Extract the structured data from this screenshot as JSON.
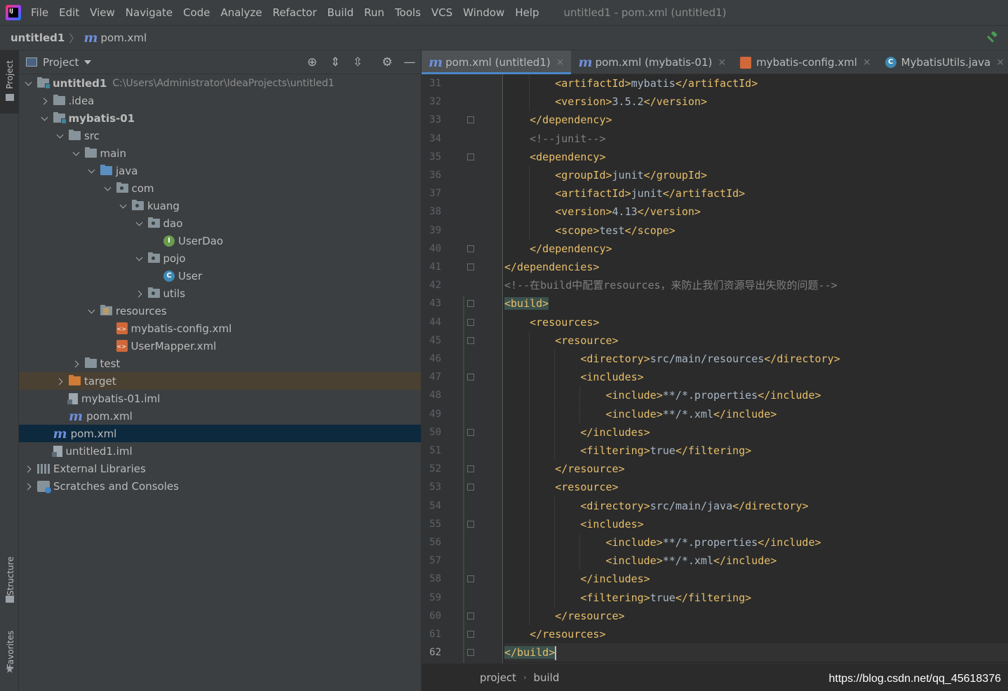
{
  "menubar": {
    "items": [
      "File",
      "Edit",
      "View",
      "Navigate",
      "Code",
      "Analyze",
      "Refactor",
      "Build",
      "Run",
      "Tools",
      "VCS",
      "Window",
      "Help"
    ],
    "window_title": "untitled1 - pom.xml (untitled1)"
  },
  "navbar": {
    "project": "untitled1",
    "file": "pom.xml"
  },
  "side_strip": {
    "project": "Project",
    "structure": "Structure",
    "favorites": "Favorites"
  },
  "project_panel": {
    "title": "Project",
    "tree": [
      {
        "label": "untitled1",
        "path": "C:\\Users\\Administrator\\IdeaProjects\\untitled1",
        "depth": 0,
        "chevron": "down",
        "icon": "module-folder-icon",
        "bold": true
      },
      {
        "label": ".idea",
        "depth": 1,
        "chevron": "right",
        "icon": "folder-icon"
      },
      {
        "label": "mybatis-01",
        "depth": 1,
        "chevron": "down",
        "icon": "module-folder-icon",
        "bold": true
      },
      {
        "label": "src",
        "depth": 2,
        "chevron": "down",
        "icon": "folder-icon"
      },
      {
        "label": "main",
        "depth": 3,
        "chevron": "down",
        "icon": "folder-icon"
      },
      {
        "label": "java",
        "depth": 4,
        "chevron": "down",
        "icon": "source-folder-icon"
      },
      {
        "label": "com",
        "depth": 5,
        "chevron": "down",
        "icon": "package-icon"
      },
      {
        "label": "kuang",
        "depth": 6,
        "chevron": "down",
        "icon": "package-icon"
      },
      {
        "label": "dao",
        "depth": 7,
        "chevron": "down",
        "icon": "package-icon"
      },
      {
        "label": "UserDao",
        "depth": 8,
        "chevron": "none",
        "icon": "interface-icon"
      },
      {
        "label": "pojo",
        "depth": 7,
        "chevron": "down",
        "icon": "package-icon"
      },
      {
        "label": "User",
        "depth": 8,
        "chevron": "none",
        "icon": "class-icon"
      },
      {
        "label": "utils",
        "depth": 7,
        "chevron": "right",
        "icon": "package-icon"
      },
      {
        "label": "resources",
        "depth": 4,
        "chevron": "down",
        "icon": "resources-folder-icon"
      },
      {
        "label": "mybatis-config.xml",
        "depth": 5,
        "chevron": "none",
        "icon": "xml-file-icon"
      },
      {
        "label": "UserMapper.xml",
        "depth": 5,
        "chevron": "none",
        "icon": "xml-file-icon"
      },
      {
        "label": "test",
        "depth": 3,
        "chevron": "right",
        "icon": "folder-icon"
      },
      {
        "label": "target",
        "depth": 2,
        "chevron": "right",
        "icon": "excluded-folder-icon",
        "state": "excluded"
      },
      {
        "label": "mybatis-01.iml",
        "depth": 2,
        "chevron": "none",
        "icon": "iml-file-icon"
      },
      {
        "label": "pom.xml",
        "depth": 2,
        "chevron": "none",
        "icon": "maven-file-icon"
      },
      {
        "label": "pom.xml",
        "depth": 1,
        "chevron": "none",
        "icon": "maven-file-icon",
        "state": "selected"
      },
      {
        "label": "untitled1.iml",
        "depth": 1,
        "chevron": "none",
        "icon": "iml-file-icon"
      },
      {
        "label": "External Libraries",
        "depth": 0,
        "chevron": "right",
        "icon": "libraries-icon"
      },
      {
        "label": "Scratches and Consoles",
        "depth": 0,
        "chevron": "right",
        "icon": "scratches-icon"
      }
    ]
  },
  "editor_tabs": [
    {
      "label": "pom.xml (untitled1)",
      "icon": "maven-file-icon",
      "active": true
    },
    {
      "label": "pom.xml (mybatis-01)",
      "icon": "maven-file-icon",
      "active": false
    },
    {
      "label": "mybatis-config.xml",
      "icon": "xml-file-icon",
      "active": false
    },
    {
      "label": "MybatisUtils.java",
      "icon": "class-icon",
      "active": false
    }
  ],
  "editor": {
    "current_line": 62,
    "lines": [
      {
        "n": 31,
        "indent": 5,
        "parts": [
          [
            "tag",
            "<artifactId>"
          ],
          [
            "txt",
            "mybatis"
          ],
          [
            "tag",
            "</artifactId>"
          ]
        ]
      },
      {
        "n": 32,
        "indent": 5,
        "parts": [
          [
            "tag",
            "<version>"
          ],
          [
            "txt",
            "3.5.2"
          ],
          [
            "tag",
            "</version>"
          ]
        ]
      },
      {
        "n": 33,
        "indent": 4,
        "fold": true,
        "parts": [
          [
            "tag",
            "</dependency>"
          ]
        ]
      },
      {
        "n": 34,
        "indent": 4,
        "parts": [
          [
            "cmt",
            "<!--junit-->"
          ]
        ]
      },
      {
        "n": 35,
        "indent": 4,
        "fold": true,
        "parts": [
          [
            "tag",
            "<dependency>"
          ]
        ]
      },
      {
        "n": 36,
        "indent": 5,
        "parts": [
          [
            "tag",
            "<groupId>"
          ],
          [
            "txt",
            "junit"
          ],
          [
            "tag",
            "</groupId>"
          ]
        ]
      },
      {
        "n": 37,
        "indent": 5,
        "parts": [
          [
            "tag",
            "<artifactId>"
          ],
          [
            "txt",
            "junit"
          ],
          [
            "tag",
            "</artifactId>"
          ]
        ]
      },
      {
        "n": 38,
        "indent": 5,
        "parts": [
          [
            "tag",
            "<version>"
          ],
          [
            "txt",
            "4.13"
          ],
          [
            "tag",
            "</version>"
          ]
        ]
      },
      {
        "n": 39,
        "indent": 5,
        "parts": [
          [
            "tag",
            "<scope>"
          ],
          [
            "txt",
            "test"
          ],
          [
            "tag",
            "</scope>"
          ]
        ]
      },
      {
        "n": 40,
        "indent": 4,
        "fold": true,
        "parts": [
          [
            "tag",
            "</dependency>"
          ]
        ]
      },
      {
        "n": 41,
        "indent": 3,
        "fold": true,
        "parts": [
          [
            "tag",
            "</dependencies>"
          ]
        ]
      },
      {
        "n": 42,
        "indent": 3,
        "parts": [
          [
            "cmt",
            "<!--在build中配置resources，来防止我们资源导出失败的问题-->"
          ]
        ]
      },
      {
        "n": 43,
        "indent": 3,
        "fold": true,
        "parts": [
          [
            "taghl",
            "<build>"
          ]
        ]
      },
      {
        "n": 44,
        "indent": 4,
        "fold": true,
        "parts": [
          [
            "tag",
            "<resources>"
          ]
        ]
      },
      {
        "n": 45,
        "indent": 5,
        "fold": true,
        "parts": [
          [
            "tag",
            "<resource>"
          ]
        ]
      },
      {
        "n": 46,
        "indent": 6,
        "parts": [
          [
            "tag",
            "<directory>"
          ],
          [
            "txt",
            "src/main/resources"
          ],
          [
            "tag",
            "</directory>"
          ]
        ]
      },
      {
        "n": 47,
        "indent": 6,
        "fold": true,
        "parts": [
          [
            "tag",
            "<includes>"
          ]
        ]
      },
      {
        "n": 48,
        "indent": 7,
        "parts": [
          [
            "tag",
            "<include>"
          ],
          [
            "txt",
            "**/*.properties"
          ],
          [
            "tag",
            "</include>"
          ]
        ]
      },
      {
        "n": 49,
        "indent": 7,
        "parts": [
          [
            "tag",
            "<include>"
          ],
          [
            "txt",
            "**/*.xml"
          ],
          [
            "tag",
            "</include>"
          ]
        ]
      },
      {
        "n": 50,
        "indent": 6,
        "fold": true,
        "parts": [
          [
            "tag",
            "</includes>"
          ]
        ]
      },
      {
        "n": 51,
        "indent": 6,
        "parts": [
          [
            "tag",
            "<filtering>"
          ],
          [
            "txt",
            "true"
          ],
          [
            "tag",
            "</filtering>"
          ]
        ]
      },
      {
        "n": 52,
        "indent": 5,
        "fold": true,
        "parts": [
          [
            "tag",
            "</resource>"
          ]
        ]
      },
      {
        "n": 53,
        "indent": 5,
        "fold": true,
        "parts": [
          [
            "tag",
            "<resource>"
          ]
        ]
      },
      {
        "n": 54,
        "indent": 6,
        "parts": [
          [
            "tag",
            "<directory>"
          ],
          [
            "txt",
            "src/main/java"
          ],
          [
            "tag",
            "</directory>"
          ]
        ]
      },
      {
        "n": 55,
        "indent": 6,
        "fold": true,
        "parts": [
          [
            "tag",
            "<includes>"
          ]
        ]
      },
      {
        "n": 56,
        "indent": 7,
        "parts": [
          [
            "tag",
            "<include>"
          ],
          [
            "txt",
            "**/*.properties"
          ],
          [
            "tag",
            "</include>"
          ]
        ]
      },
      {
        "n": 57,
        "indent": 7,
        "parts": [
          [
            "tag",
            "<include>"
          ],
          [
            "txt",
            "**/*.xml"
          ],
          [
            "tag",
            "</include>"
          ]
        ]
      },
      {
        "n": 58,
        "indent": 6,
        "fold": true,
        "parts": [
          [
            "tag",
            "</includes>"
          ]
        ]
      },
      {
        "n": 59,
        "indent": 6,
        "parts": [
          [
            "tag",
            "<filtering>"
          ],
          [
            "txt",
            "true"
          ],
          [
            "tag",
            "</filtering>"
          ]
        ]
      },
      {
        "n": 60,
        "indent": 5,
        "fold": true,
        "parts": [
          [
            "tag",
            "</resource>"
          ]
        ]
      },
      {
        "n": 61,
        "indent": 4,
        "fold": true,
        "parts": [
          [
            "tag",
            "</resources>"
          ]
        ]
      },
      {
        "n": 62,
        "indent": 3,
        "fold": true,
        "caret": true,
        "parts": [
          [
            "taghl",
            "</build>"
          ]
        ]
      }
    ]
  },
  "breadcrumbs": [
    "project",
    "build"
  ],
  "watermark": "https://blog.csdn.net/qq_45618376",
  "colors": {
    "tag": "#e8bf6a",
    "text": "#a9b7c6",
    "comment": "#808080",
    "line_number": "#606366",
    "selection": "#0d293e",
    "accent_tab": "#4a88c7",
    "build_accent": "#499c54"
  }
}
